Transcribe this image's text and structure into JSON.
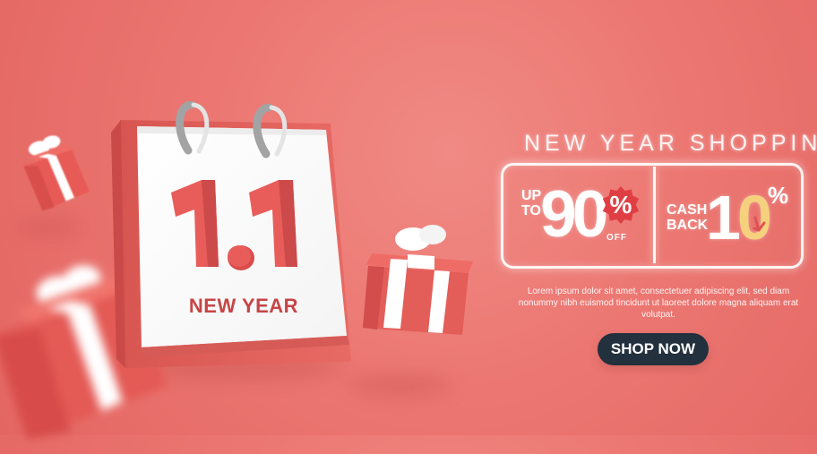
{
  "calendar": {
    "big_text": "1.1",
    "caption": "NEW YEAR"
  },
  "promo": {
    "title": "NEW YEAR SHOPPING",
    "left_offer_label": "UP TO",
    "left_offer_value": "90",
    "left_offer_badge": "%",
    "left_offer_suffix": "OFF",
    "right_offer_label": "CASH BACK",
    "right_offer_value_prefix": "1",
    "right_offer_value_highlight": "0",
    "right_offer_percent": "%",
    "description": "Lorem ipsum dolor sit amet, consectetuer adipiscing elit, sed diam nonummy nibh euismod tincidunt ut laoreet dolore magna aliquam erat volutpat.",
    "button": "SHOP NOW"
  },
  "colors": {
    "background": "#ec7772",
    "accent_red": "#df3f43",
    "dark_button": "#23303d",
    "highlight_yellow": "#f5d17e",
    "white": "#ffffff"
  },
  "icons": {
    "calendar": "calendar-icon",
    "gift": "gift-icon",
    "discount_badge": "discount-badge-icon",
    "arrow": "down-arrow-icon"
  }
}
